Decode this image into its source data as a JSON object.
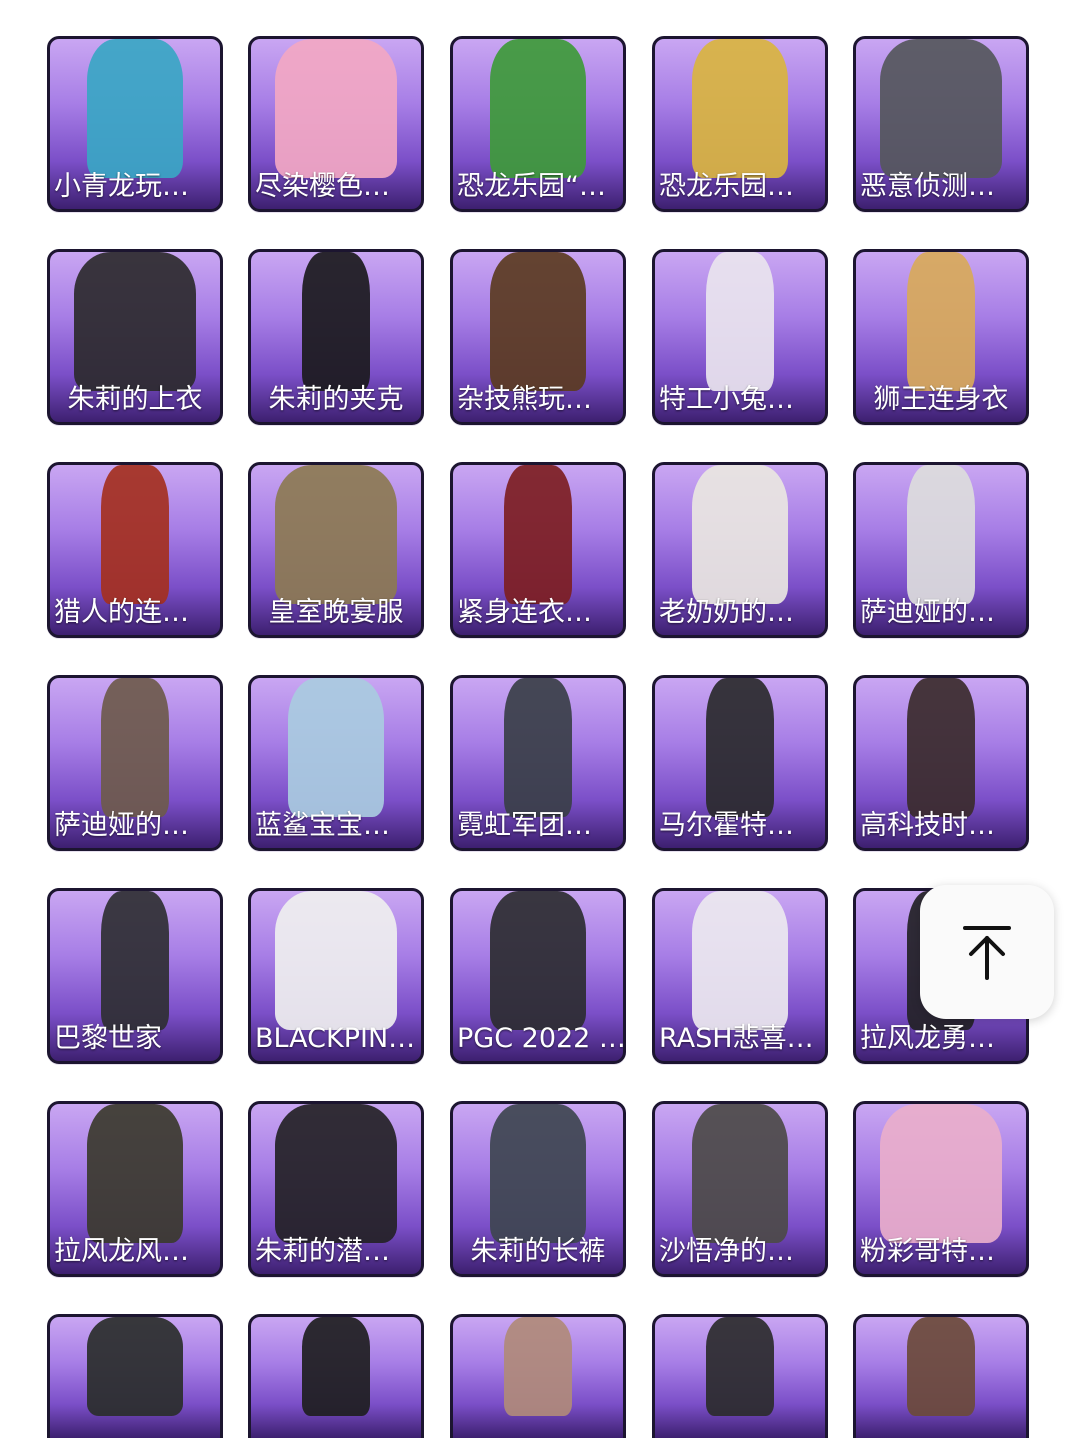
{
  "items": [
    {
      "label": "小青龙玩…",
      "art": "#3aa6c4"
    },
    {
      "label": "尽染樱色…",
      "art": "#f2a7c3"
    },
    {
      "label": "恐龙乐园“…",
      "art": "#3e9a3a"
    },
    {
      "label": "恐龙乐园…",
      "art": "#d9b440"
    },
    {
      "label": "恶意侦测…",
      "art": "#55575c"
    },
    {
      "label": "朱莉的上衣",
      "art": "#2c2a2e",
      "center": true
    },
    {
      "label": "朱莉的夹克",
      "art": "#1b1a1d",
      "center": true
    },
    {
      "label": "杂技熊玩…",
      "art": "#5b3b21"
    },
    {
      "label": "特工小兔…",
      "art": "#e9e4ee"
    },
    {
      "label": "狮王连身衣",
      "art": "#d8a95a",
      "center": true
    },
    {
      "label": "猎人的连…",
      "art": "#a4301f"
    },
    {
      "label": "皇室晚宴服",
      "art": "#8c7a52",
      "center": true
    },
    {
      "label": "紧身连衣…",
      "art": "#7d1e22"
    },
    {
      "label": "老奶奶的…",
      "art": "#e9e6e1"
    },
    {
      "label": "萨迪娅的…",
      "art": "#dcdcdc"
    },
    {
      "label": "萨迪娅的…",
      "art": "#6e5a4c"
    },
    {
      "label": "蓝鲨宝宝…",
      "art": "#a9cbe0"
    },
    {
      "label": "霓虹军团…",
      "art": "#3a3f48"
    },
    {
      "label": "马尔霍特…",
      "art": "#2a2a2c"
    },
    {
      "label": "高科技时…",
      "art": "#3b2b2c"
    },
    {
      "label": "巴黎世家",
      "art": "#2f2f33"
    },
    {
      "label": "BLACKPIN…",
      "art": "#efefef"
    },
    {
      "label": "PGC 2022 …",
      "art": "#2c2d31"
    },
    {
      "label": "RASH悲喜…",
      "art": "#ece8ef"
    },
    {
      "label": "拉风龙勇…",
      "art": "#232226"
    },
    {
      "label": "拉风龙风…",
      "art": "#3b3a2e"
    },
    {
      "label": "朱莉的潜…",
      "art": "#242226"
    },
    {
      "label": "朱莉的长裤",
      "art": "#3e4550",
      "center": true
    },
    {
      "label": "沙悟净的…",
      "art": "#4c4a48"
    },
    {
      "label": "粉彩哥特…",
      "art": "#e9aecb"
    },
    {
      "label": "",
      "art": "#2a2e2b"
    },
    {
      "label": "",
      "art": "#1e1e20"
    },
    {
      "label": "",
      "art": "#b08a7a"
    },
    {
      "label": "",
      "art": "#2b2b2d"
    },
    {
      "label": "",
      "art": "#6b4a3a"
    }
  ],
  "back_to_top": {
    "icon": "arrow-up-to-top-icon"
  }
}
